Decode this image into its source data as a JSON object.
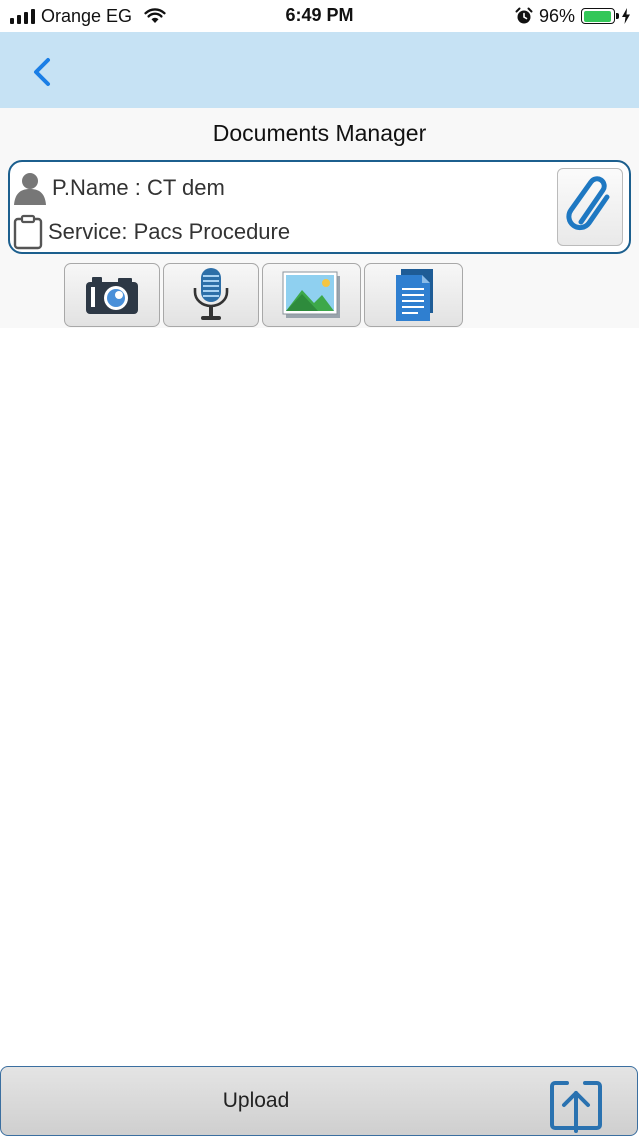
{
  "status_bar": {
    "carrier": "Orange EG",
    "time": "6:49 PM",
    "battery_percent": "96%",
    "battery_level": 0.96,
    "battery_color": "#34c759"
  },
  "nav": {
    "back_icon": "chevron-left-icon",
    "accent_color": "#1a7ee6",
    "background": "#c6e2f4"
  },
  "page": {
    "title": "Documents Manager"
  },
  "info_card": {
    "patient_label": "P.Name : CT dem",
    "service_label": "Service: Pacs Procedure",
    "patient_icon": "person-icon",
    "service_icon": "clipboard-icon",
    "attach_icon": "paperclip-icon",
    "border_color": "#1c5f8e"
  },
  "tools": [
    {
      "icon": "camera-icon"
    },
    {
      "icon": "microphone-icon"
    },
    {
      "icon": "image-gallery-icon"
    },
    {
      "icon": "document-icon"
    }
  ],
  "footer": {
    "upload_label": "Upload",
    "upload_icon": "upload-arrow-icon"
  }
}
